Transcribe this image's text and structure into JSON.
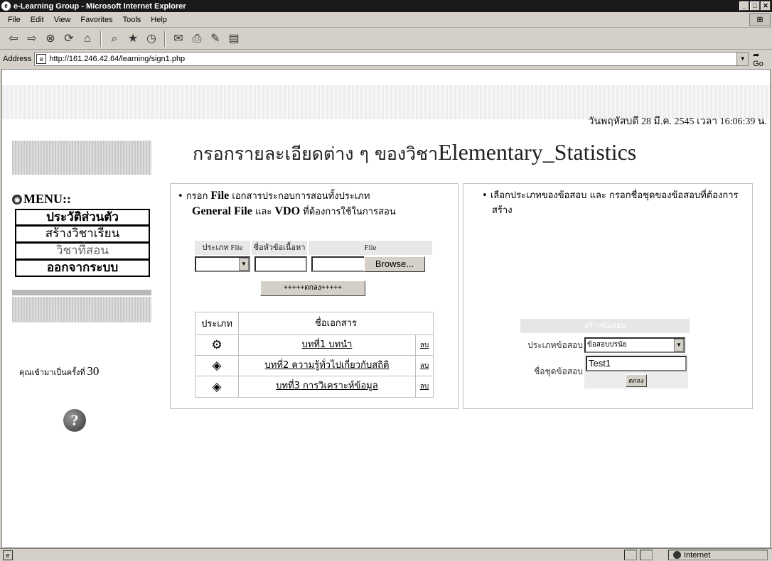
{
  "window": {
    "title": "e-Learning Group - Microsoft Internet Explorer",
    "ie_icon": "e",
    "buttons": {
      "minimize": "_",
      "maximize": "□",
      "close": "✕"
    }
  },
  "menubar": {
    "items": [
      "File",
      "Edit",
      "View",
      "Favorites",
      "Tools",
      "Help"
    ],
    "throbber": "⊞"
  },
  "toolbar": {
    "icons": [
      "back-icon",
      "forward-icon",
      "stop-icon",
      "refresh-icon",
      "home-icon",
      "search-icon",
      "favorites-icon",
      "history-icon",
      "mail-icon",
      "print-icon",
      "edit-icon",
      "discuss-icon"
    ],
    "glyphs": {
      "back": "⇦",
      "forward": "⇨",
      "stop": "⊗",
      "refresh": "⟳",
      "home": "⌂",
      "search": "⌕",
      "favorites": "★",
      "history": "◷",
      "mail": "✉",
      "print": "⎙",
      "edit": "✎",
      "discuss": "▤"
    }
  },
  "address": {
    "label": "Address",
    "url": "http://161.246.42.64/learning/sign1.php",
    "go_label": "Go"
  },
  "page": {
    "datetime": "วันพฤหัสบดี 28 มี.ค. 2545 เวลา 16:06:39 น.",
    "heading_thai": "กรอกรายละเอียดต่าง ๆ ของวิชา",
    "heading_course": "Elementary_Statistics",
    "menu": {
      "title": "MENU::",
      "items": [
        {
          "label": "ประวัติส่วนตัว",
          "style": "bold"
        },
        {
          "label": "สร้างวิชาเรียน",
          "style": "normal"
        },
        {
          "label": "วิชาที่สอน",
          "style": "gray"
        },
        {
          "label": "ออกจากระบบ",
          "style": "bold"
        }
      ]
    },
    "visits": {
      "label": "คุณเข้ามาเป็นครั้งที่",
      "count": "30"
    },
    "help_glyph": "?",
    "upload_panel": {
      "bullet_pre": "กรอก",
      "bullet_file": "File",
      "bullet_mid": "เอกสารประกอบการสอนทั้งประเภท",
      "bullet_general": "General File",
      "bullet_and": "และ",
      "bullet_vdo": "VDO",
      "bullet_post": "ที่ต้องการใช้ในการสอน",
      "col_type": "ประเภท File",
      "col_topic": "ชื่อหัวข้อเนื้อหา",
      "col_file": "File",
      "browse_label": "Browse...",
      "submit_label": "+++++ตกลง+++++",
      "table_head_type": "ประเภท",
      "table_head_name": "ชื่อเอกสาร",
      "delete_label": "ลบ",
      "documents": [
        {
          "icon": "⚙",
          "name": "บทที่1 บทนำ"
        },
        {
          "icon": "◈",
          "name": "บทที่2 ความรู้ทั่วไปเกี่ยวกับสถิติ"
        },
        {
          "icon": "◈",
          "name": "บทที่3 การวิเคราะห์ข้อมูล"
        }
      ]
    },
    "exam_panel": {
      "bullet": "เลือกประเภทของข้อสอบ และ กรอกชื่อชุดของข้อสอบที่ต้องการสร้าง",
      "header": "สร้างข้อสอบ",
      "type_label": "ประเภทข้อสอบ",
      "type_value": "ข้อสอบปรนัย",
      "name_label": "ชื่อชุดข้อสอบ",
      "name_value": "Test1",
      "ok_label": "ตกลง"
    }
  },
  "statusbar": {
    "page_icon": "e",
    "zone": "Internet"
  }
}
